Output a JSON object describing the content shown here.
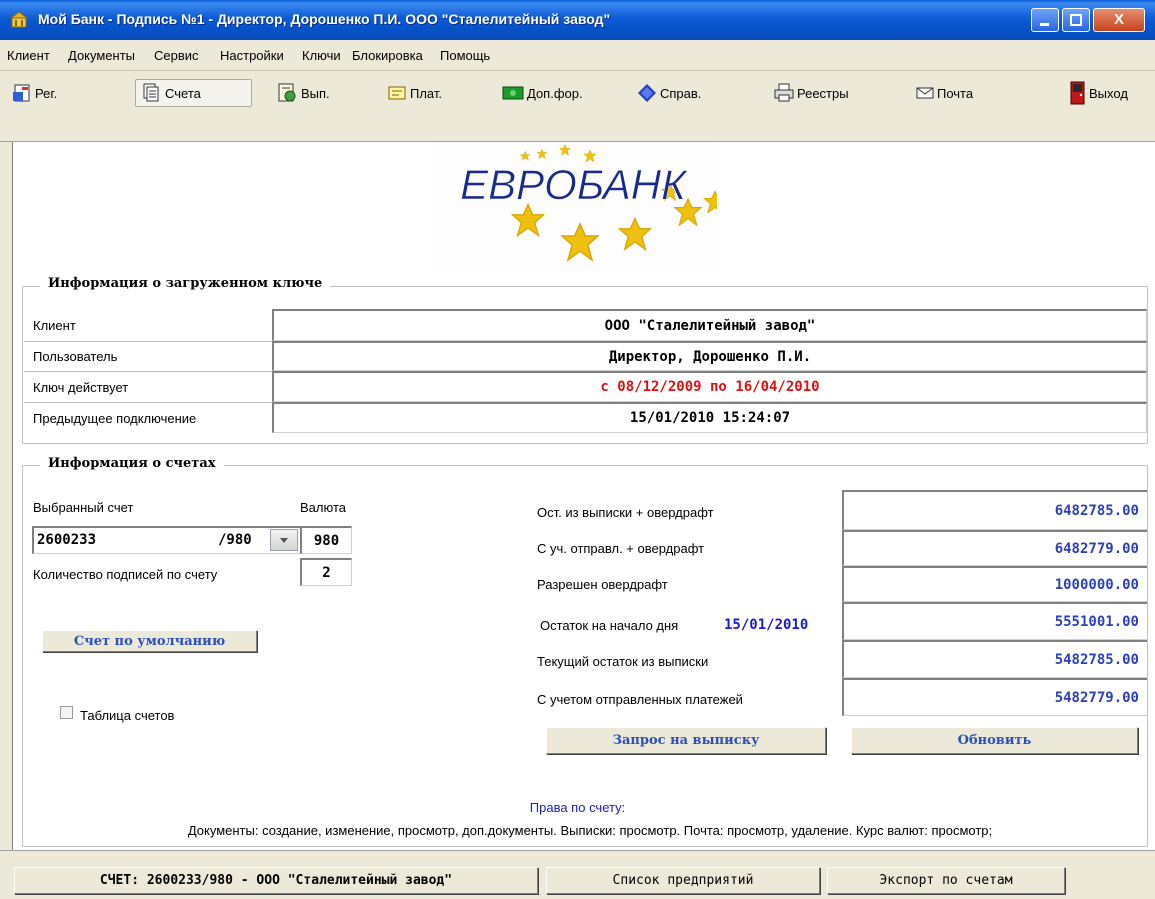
{
  "window": {
    "title": "Мой Банк - Подпись №1 - Директор, Дорошенко П.И.  ООО \"Сталелитейный завод\"",
    "close_label": "X"
  },
  "menu": [
    "Клиент",
    "Документы",
    "Сервис",
    "Настройки",
    "Ключи",
    "Блокировка",
    "Помощь"
  ],
  "toolbar": {
    "reg": "Рег.",
    "accounts": "Счета",
    "statements": "Вып.",
    "payments": "Плат.",
    "extra_forms": "Доп.фор.",
    "reference": "Справ.",
    "registries": "Реестры",
    "mail": "Почта",
    "exit": "Выход"
  },
  "logo": {
    "text": "ЕВРОБАНК"
  },
  "key_info": {
    "heading": "Информация о загруженном ключе",
    "client_label": "Клиент",
    "client_value": "ООО \"Сталелитейный завод\"",
    "user_label": "Пользователь",
    "user_value": "Директор, Дорошенко П.И.",
    "validity_label": "Ключ действует",
    "validity_value": "с 08/12/2009 по 16/04/2010",
    "prev_label": "Предыдущее подключение",
    "prev_value": "15/01/2010 15:24:07"
  },
  "accounts_info": {
    "heading": "Информация о счетах",
    "selected_label": "Выбранный счет",
    "currency_label": "Валюта",
    "account_value": "2600233",
    "account_suffix": "/980",
    "currency_value": "980",
    "signatures_label": "Количество подписей по счету",
    "signatures_value": "2",
    "default_button": "Счет по умолчанию",
    "table_checkbox_label": "Таблица счетов",
    "balance_overdraft_label": "Ост. из выписки + овердрафт",
    "balance_overdraft_value": "6482785.00",
    "sent_overdraft_label": "С уч. отправл. + овердрафт",
    "sent_overdraft_value": "6482779.00",
    "allowed_overdraft_label": "Разрешен овердрафт",
    "allowed_overdraft_value": "1000000.00",
    "opening_label": "Остаток на начало дня",
    "opening_date": "15/01/2010",
    "opening_value": "5551001.00",
    "current_label": "Текущий остаток из выписки",
    "current_value": "5482785.00",
    "with_sent_label": "С учетом отправленных платежей",
    "with_sent_value": "5482779.00",
    "request_button": "Запрос на выписку",
    "refresh_button": "Обновить",
    "rights_title": "Права по счету:",
    "rights_text": "Документы: создание, изменение, просмотр, доп.документы. Выписки: просмотр. Почта: просмотр, удаление. Курс валют: просмотр;"
  },
  "bottom": {
    "account_button": "СЧЕТ: 2600233/980 - ООО \"Сталелитейный завод\"",
    "companies_button": "Список предприятий",
    "export_button": "Экспорт по счетам"
  },
  "colors": {
    "titlebar": "#0552c8",
    "value_blue": "#2b3fbf",
    "validity_red": "#e01010",
    "rights_blue": "#1a1ad0"
  }
}
